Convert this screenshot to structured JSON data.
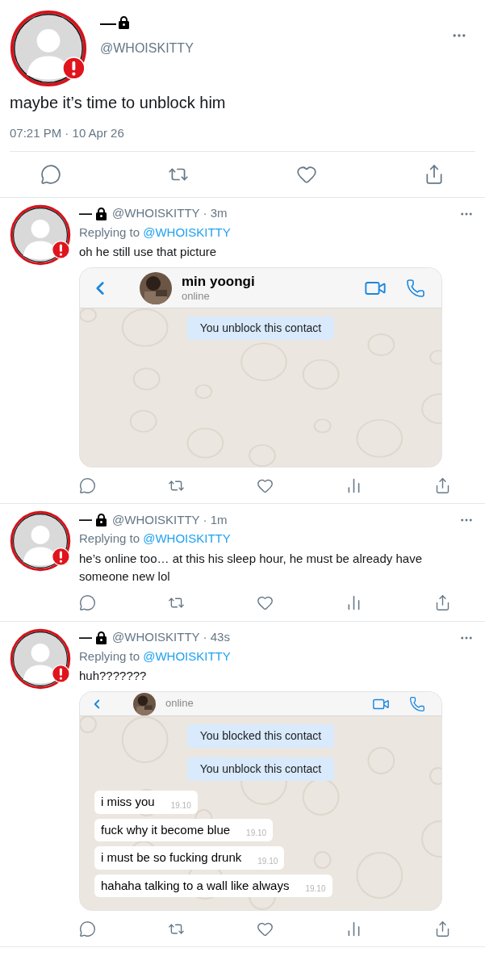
{
  "main_tweet": {
    "name": "—",
    "handle": "@WHOISKITTY",
    "text": "maybe it’s time to unblock him",
    "timestamp": "07:21 PM · 10 Apr 26"
  },
  "replies": [
    {
      "name": "—",
      "handle": "@WHOISKITTY",
      "time": "· 3m",
      "replying_label": "Replying to",
      "replying_handle": "@WHOISKITTY",
      "text": "oh he still use that picture",
      "attachment": {
        "kind": "chat",
        "contact_name": "min yoongi",
        "status": "online",
        "messages": [
          {
            "kind": "system",
            "text": "You unblock this contact"
          }
        ]
      }
    },
    {
      "name": "—",
      "handle": "@WHOISKITTY",
      "time": "· 1m",
      "replying_label": "Replying to",
      "replying_handle": "@WHOISKITTY",
      "text": "he’s online too… at this his sleep hour, he must be already have someone new lol"
    },
    {
      "name": "—",
      "handle": "@WHOISKITTY",
      "time": "· 43s",
      "replying_label": "Replying to",
      "replying_handle": "@WHOISKITTY",
      "text": "huh???????",
      "attachment": {
        "kind": "chat",
        "status": "online",
        "messages": [
          {
            "kind": "system",
            "text": "You blocked this contact"
          },
          {
            "kind": "system",
            "text": "You unblock this contact"
          },
          {
            "kind": "incoming",
            "text": "i miss you",
            "time": "19.10"
          },
          {
            "kind": "incoming",
            "text": "fuck why it become blue",
            "time": "19.10"
          },
          {
            "kind": "incoming",
            "text": "i must be so fucking drunk",
            "time": "19.10"
          },
          {
            "kind": "incoming",
            "text": "hahaha talking to a wall like always",
            "time": "19.10"
          }
        ]
      }
    }
  ]
}
